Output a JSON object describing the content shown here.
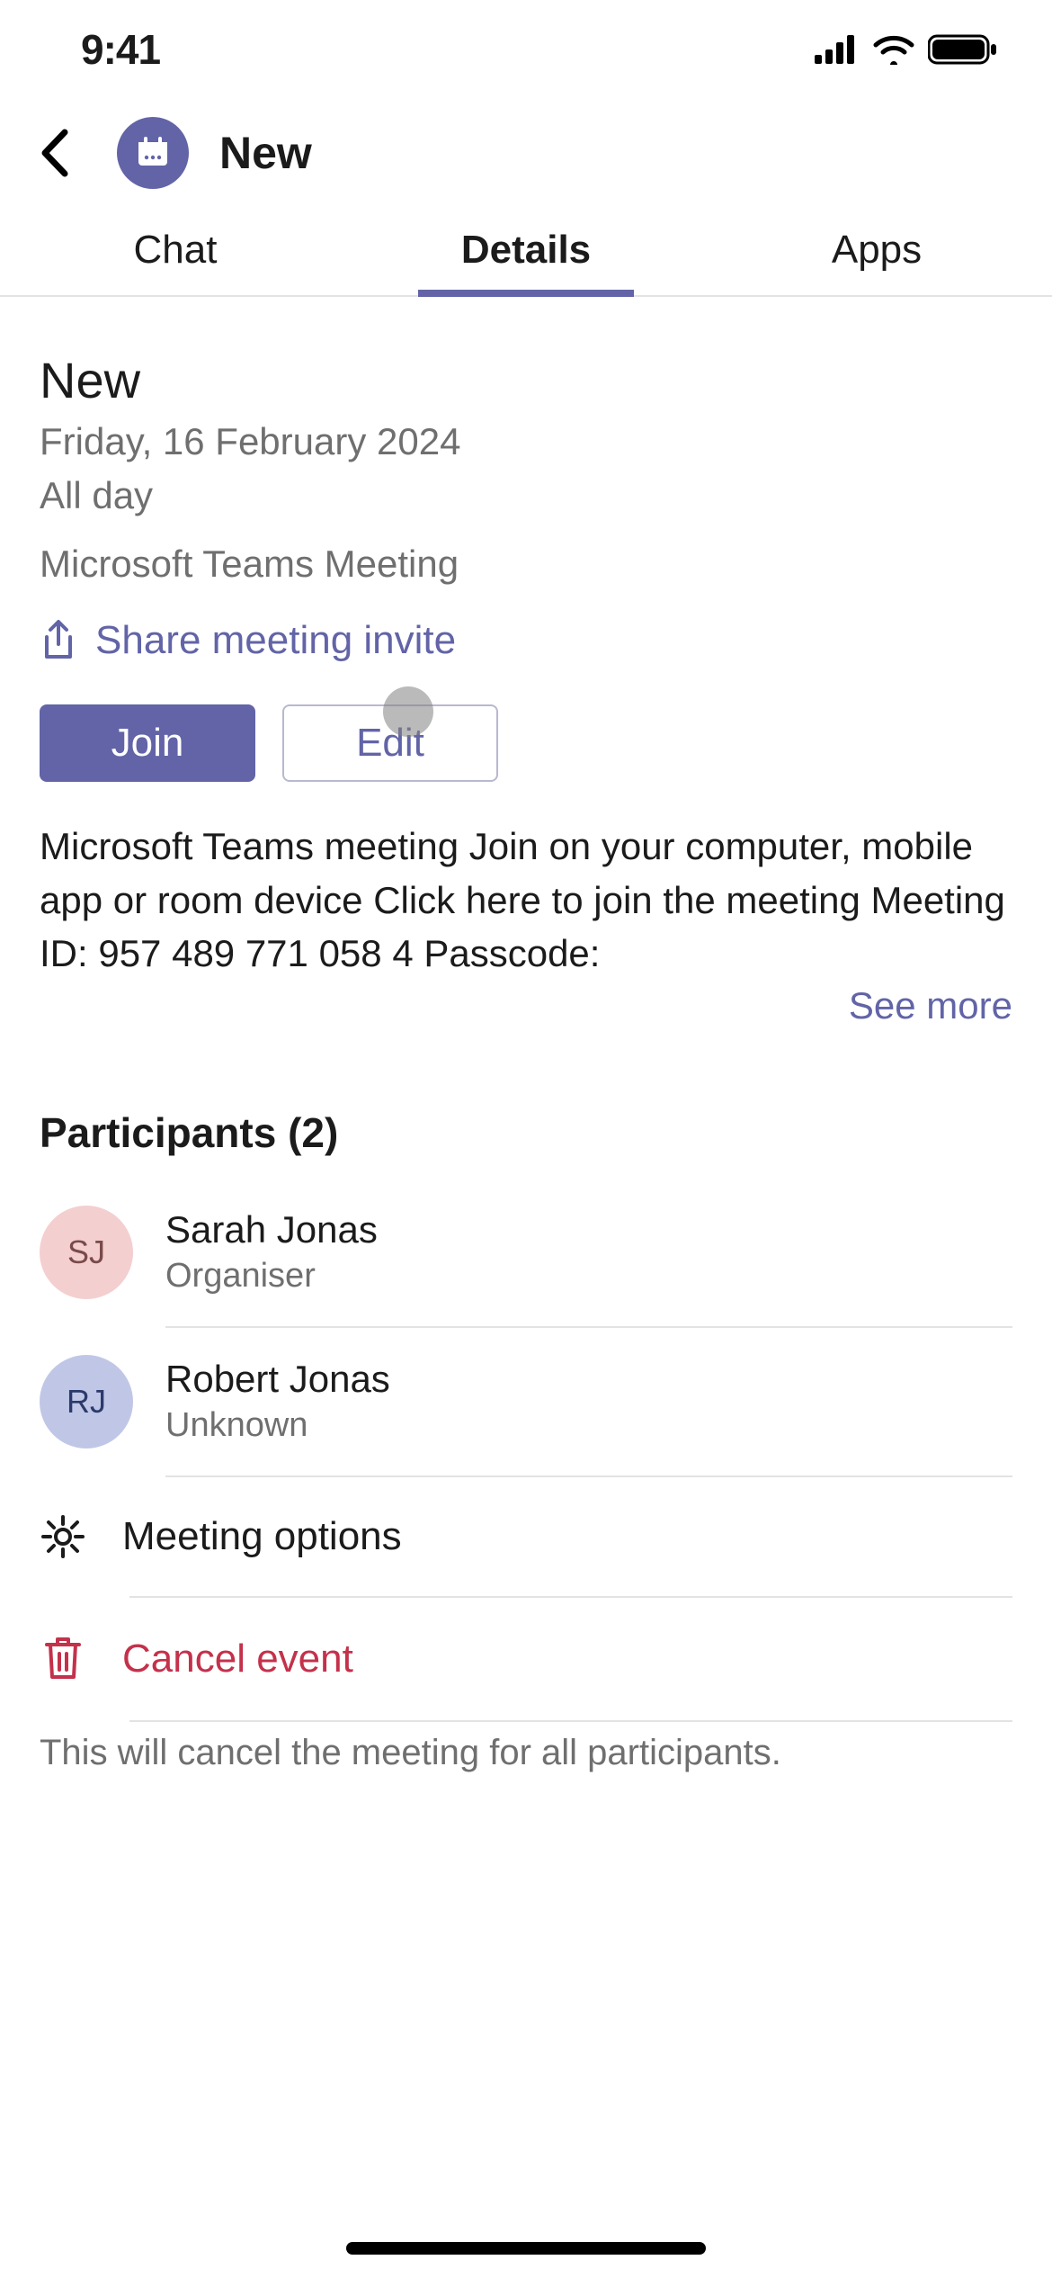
{
  "status_bar": {
    "time": "9:41"
  },
  "header": {
    "title": "New"
  },
  "tabs": {
    "chat": "Chat",
    "details": "Details",
    "apps": "Apps",
    "active": "Details"
  },
  "meeting": {
    "title": "New",
    "date": "Friday, 16 February 2024",
    "allday": "All day",
    "type": "Microsoft Teams Meeting",
    "share_label": "Share meeting invite",
    "join_label": "Join",
    "edit_label": "Edit",
    "description": "Microsoft Teams meeting Join on your computer, mobile app or room device Click here to join the meeting Meeting ID: 957 489 771 058 4 Passcode:",
    "see_more": "See more"
  },
  "participants": {
    "heading": "Participants (2)",
    "list": [
      {
        "initials": "SJ",
        "name": "Sarah Jonas",
        "role": "Organiser",
        "color": "pink"
      },
      {
        "initials": "RJ",
        "name": "Robert Jonas",
        "role": "Unknown",
        "color": "blue"
      }
    ]
  },
  "options": {
    "meeting_options": "Meeting options",
    "cancel_event": "Cancel event",
    "cancel_note": "This will cancel the meeting for all participants."
  },
  "colors": {
    "accent": "#6264a7",
    "danger": "#c4314b"
  }
}
